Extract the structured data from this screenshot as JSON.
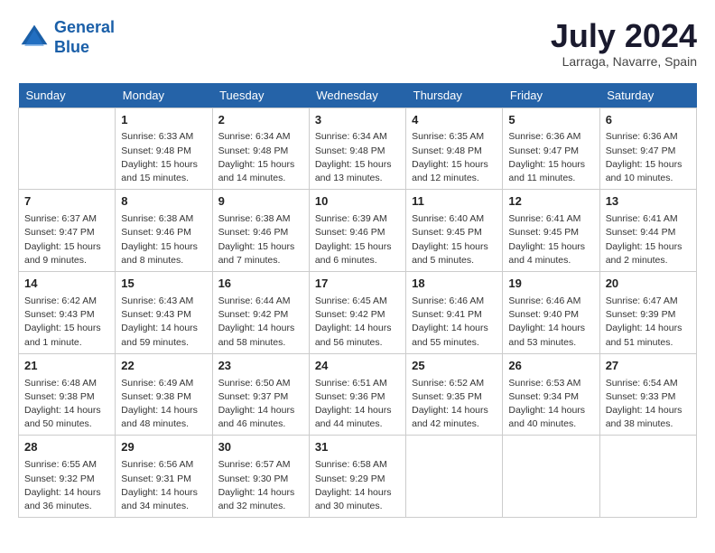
{
  "header": {
    "logo_line1": "General",
    "logo_line2": "Blue",
    "month_year": "July 2024",
    "location": "Larraga, Navarre, Spain"
  },
  "days_of_week": [
    "Sunday",
    "Monday",
    "Tuesday",
    "Wednesday",
    "Thursday",
    "Friday",
    "Saturday"
  ],
  "weeks": [
    [
      {
        "day": "",
        "content": ""
      },
      {
        "day": "1",
        "content": "Sunrise: 6:33 AM\nSunset: 9:48 PM\nDaylight: 15 hours\nand 15 minutes."
      },
      {
        "day": "2",
        "content": "Sunrise: 6:34 AM\nSunset: 9:48 PM\nDaylight: 15 hours\nand 14 minutes."
      },
      {
        "day": "3",
        "content": "Sunrise: 6:34 AM\nSunset: 9:48 PM\nDaylight: 15 hours\nand 13 minutes."
      },
      {
        "day": "4",
        "content": "Sunrise: 6:35 AM\nSunset: 9:48 PM\nDaylight: 15 hours\nand 12 minutes."
      },
      {
        "day": "5",
        "content": "Sunrise: 6:36 AM\nSunset: 9:47 PM\nDaylight: 15 hours\nand 11 minutes."
      },
      {
        "day": "6",
        "content": "Sunrise: 6:36 AM\nSunset: 9:47 PM\nDaylight: 15 hours\nand 10 minutes."
      }
    ],
    [
      {
        "day": "7",
        "content": "Sunrise: 6:37 AM\nSunset: 9:47 PM\nDaylight: 15 hours\nand 9 minutes."
      },
      {
        "day": "8",
        "content": "Sunrise: 6:38 AM\nSunset: 9:46 PM\nDaylight: 15 hours\nand 8 minutes."
      },
      {
        "day": "9",
        "content": "Sunrise: 6:38 AM\nSunset: 9:46 PM\nDaylight: 15 hours\nand 7 minutes."
      },
      {
        "day": "10",
        "content": "Sunrise: 6:39 AM\nSunset: 9:46 PM\nDaylight: 15 hours\nand 6 minutes."
      },
      {
        "day": "11",
        "content": "Sunrise: 6:40 AM\nSunset: 9:45 PM\nDaylight: 15 hours\nand 5 minutes."
      },
      {
        "day": "12",
        "content": "Sunrise: 6:41 AM\nSunset: 9:45 PM\nDaylight: 15 hours\nand 4 minutes."
      },
      {
        "day": "13",
        "content": "Sunrise: 6:41 AM\nSunset: 9:44 PM\nDaylight: 15 hours\nand 2 minutes."
      }
    ],
    [
      {
        "day": "14",
        "content": "Sunrise: 6:42 AM\nSunset: 9:43 PM\nDaylight: 15 hours\nand 1 minute."
      },
      {
        "day": "15",
        "content": "Sunrise: 6:43 AM\nSunset: 9:43 PM\nDaylight: 14 hours\nand 59 minutes."
      },
      {
        "day": "16",
        "content": "Sunrise: 6:44 AM\nSunset: 9:42 PM\nDaylight: 14 hours\nand 58 minutes."
      },
      {
        "day": "17",
        "content": "Sunrise: 6:45 AM\nSunset: 9:42 PM\nDaylight: 14 hours\nand 56 minutes."
      },
      {
        "day": "18",
        "content": "Sunrise: 6:46 AM\nSunset: 9:41 PM\nDaylight: 14 hours\nand 55 minutes."
      },
      {
        "day": "19",
        "content": "Sunrise: 6:46 AM\nSunset: 9:40 PM\nDaylight: 14 hours\nand 53 minutes."
      },
      {
        "day": "20",
        "content": "Sunrise: 6:47 AM\nSunset: 9:39 PM\nDaylight: 14 hours\nand 51 minutes."
      }
    ],
    [
      {
        "day": "21",
        "content": "Sunrise: 6:48 AM\nSunset: 9:38 PM\nDaylight: 14 hours\nand 50 minutes."
      },
      {
        "day": "22",
        "content": "Sunrise: 6:49 AM\nSunset: 9:38 PM\nDaylight: 14 hours\nand 48 minutes."
      },
      {
        "day": "23",
        "content": "Sunrise: 6:50 AM\nSunset: 9:37 PM\nDaylight: 14 hours\nand 46 minutes."
      },
      {
        "day": "24",
        "content": "Sunrise: 6:51 AM\nSunset: 9:36 PM\nDaylight: 14 hours\nand 44 minutes."
      },
      {
        "day": "25",
        "content": "Sunrise: 6:52 AM\nSunset: 9:35 PM\nDaylight: 14 hours\nand 42 minutes."
      },
      {
        "day": "26",
        "content": "Sunrise: 6:53 AM\nSunset: 9:34 PM\nDaylight: 14 hours\nand 40 minutes."
      },
      {
        "day": "27",
        "content": "Sunrise: 6:54 AM\nSunset: 9:33 PM\nDaylight: 14 hours\nand 38 minutes."
      }
    ],
    [
      {
        "day": "28",
        "content": "Sunrise: 6:55 AM\nSunset: 9:32 PM\nDaylight: 14 hours\nand 36 minutes."
      },
      {
        "day": "29",
        "content": "Sunrise: 6:56 AM\nSunset: 9:31 PM\nDaylight: 14 hours\nand 34 minutes."
      },
      {
        "day": "30",
        "content": "Sunrise: 6:57 AM\nSunset: 9:30 PM\nDaylight: 14 hours\nand 32 minutes."
      },
      {
        "day": "31",
        "content": "Sunrise: 6:58 AM\nSunset: 9:29 PM\nDaylight: 14 hours\nand 30 minutes."
      },
      {
        "day": "",
        "content": ""
      },
      {
        "day": "",
        "content": ""
      },
      {
        "day": "",
        "content": ""
      }
    ]
  ]
}
